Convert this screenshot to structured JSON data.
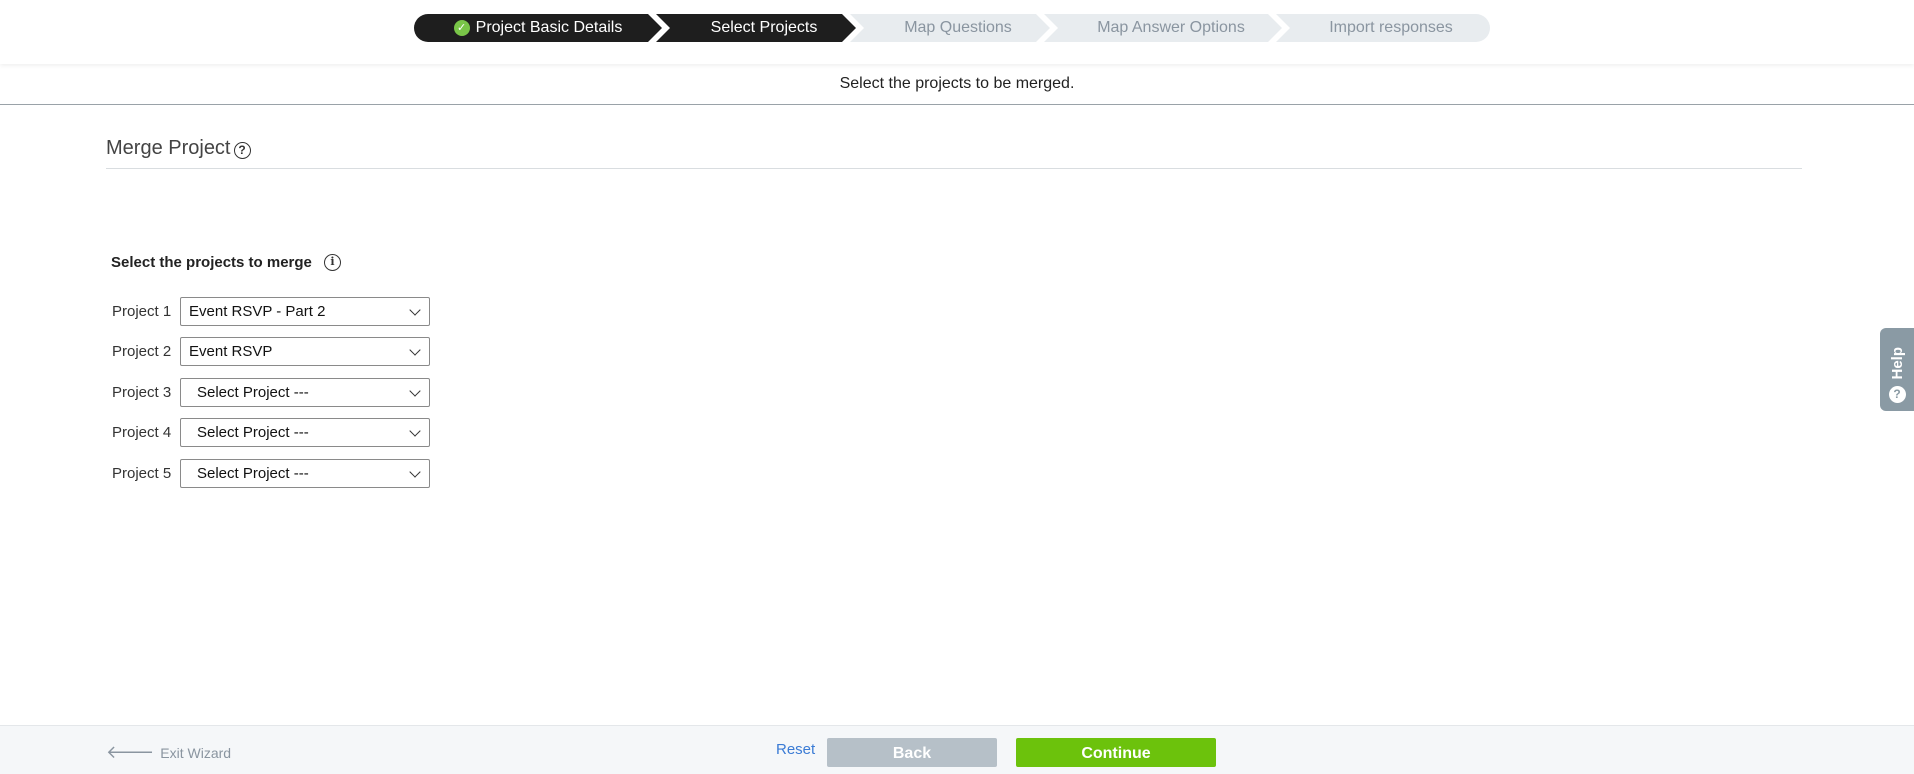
{
  "wizard": {
    "steps": [
      {
        "label": "Project Basic Details",
        "state": "done"
      },
      {
        "label": "Select Projects",
        "state": "active"
      },
      {
        "label": "Map Questions",
        "state": "pending"
      },
      {
        "label": "Map Answer Options",
        "state": "pending"
      },
      {
        "label": "Import responses",
        "state": "pending"
      }
    ],
    "check_glyph": "✓"
  },
  "subheader": {
    "text": "Select the projects to be merged."
  },
  "section": {
    "title": "Merge Project",
    "help_glyph": "?"
  },
  "form": {
    "heading": "Select the projects to merge",
    "info_glyph": "i",
    "projects": [
      {
        "label": "Project 1",
        "value": "Event RSVP - Part 2"
      },
      {
        "label": "Project 2",
        "value": "Event RSVP"
      },
      {
        "label": "Project 3",
        "value": "Select Project ---"
      },
      {
        "label": "Project 4",
        "value": "Select Project ---"
      },
      {
        "label": "Project 5",
        "value": "Select Project ---"
      }
    ]
  },
  "help_tab": {
    "label": "Help",
    "glyph": "?"
  },
  "footer": {
    "exit_label": "Exit Wizard",
    "exit_glyph": "🡐",
    "reset_label": "Reset",
    "back_label": "Back",
    "continue_label": "Continue"
  },
  "colors": {
    "step_dark": "#1e1e1e",
    "step_pending": "#e8ecef",
    "continue_green": "#6cc20c",
    "back_gray": "#b6c0c8",
    "link_blue": "#3a7bd5"
  }
}
